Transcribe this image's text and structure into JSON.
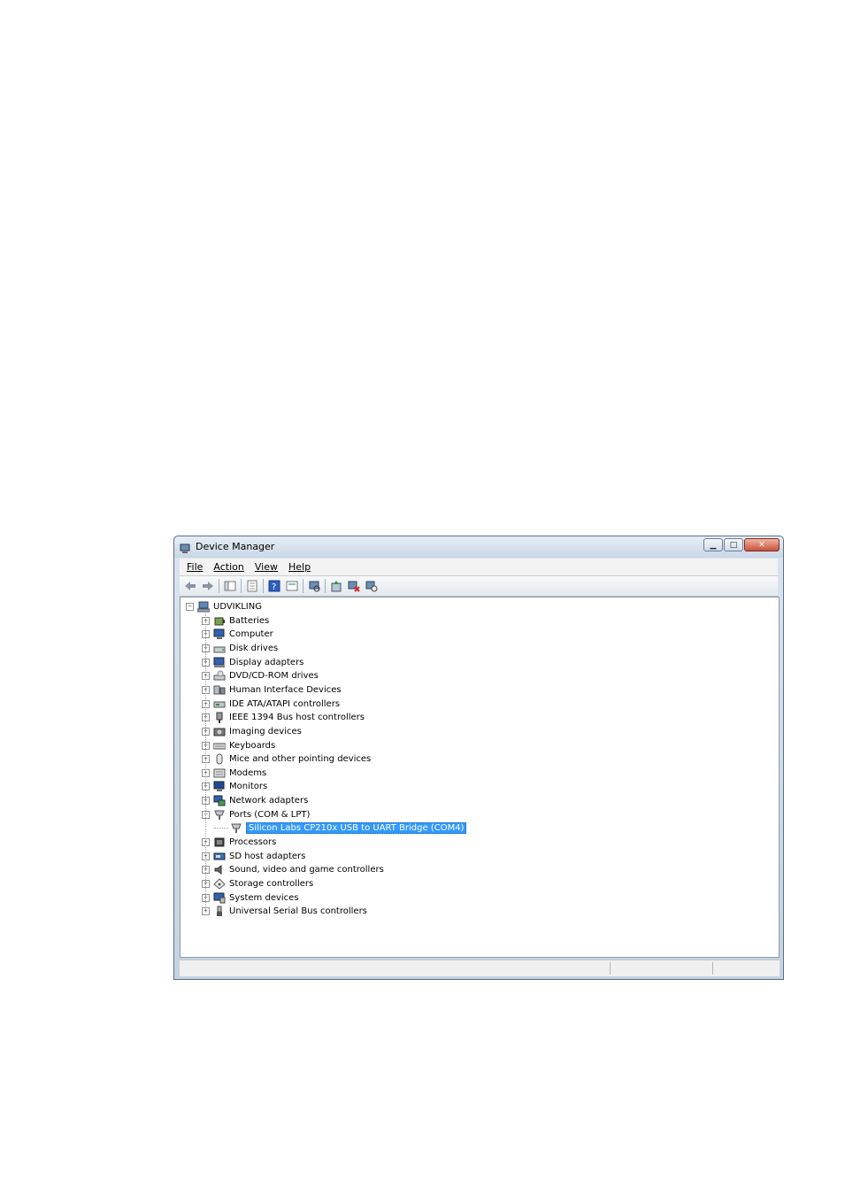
{
  "window": {
    "title": "Device Manager"
  },
  "window_buttons": [
    "minimize",
    "maximize",
    "close"
  ],
  "menu": [
    "File",
    "Action",
    "View",
    "Help"
  ],
  "toolbar_icons": [
    "back-icon",
    "forward-icon",
    "separator",
    "show-hide-tree-icon",
    "separator",
    "properties-icon",
    "separator",
    "help-icon",
    "action-view-icon",
    "separator",
    "scan-hardware-icon",
    "separator",
    "update-driver-icon",
    "uninstall-icon",
    "disable-icon"
  ],
  "tree": {
    "root": "UDVIKLING",
    "categories": [
      {
        "label": "Batteries",
        "icon": "battery-icon"
      },
      {
        "label": "Computer",
        "icon": "computer-icon"
      },
      {
        "label": "Disk drives",
        "icon": "disk-drive-icon"
      },
      {
        "label": "Display adapters",
        "icon": "display-adapter-icon"
      },
      {
        "label": "DVD/CD-ROM drives",
        "icon": "dvd-drive-icon"
      },
      {
        "label": "Human Interface Devices",
        "icon": "hid-icon"
      },
      {
        "label": "IDE ATA/ATAPI controllers",
        "icon": "ide-controller-icon"
      },
      {
        "label": "IEEE 1394 Bus host controllers",
        "icon": "ieee1394-icon"
      },
      {
        "label": "Imaging devices",
        "icon": "camera-icon"
      },
      {
        "label": "Keyboards",
        "icon": "keyboard-icon"
      },
      {
        "label": "Mice and other pointing devices",
        "icon": "mouse-icon"
      },
      {
        "label": "Modems",
        "icon": "modem-icon"
      },
      {
        "label": "Monitors",
        "icon": "monitor-icon"
      },
      {
        "label": "Network adapters",
        "icon": "network-adapter-icon"
      },
      {
        "label": "Ports (COM & LPT)",
        "icon": "port-icon",
        "expanded": true,
        "children": [
          {
            "label": "Silicon Labs CP210x USB to UART Bridge (COM4)",
            "icon": "port-icon",
            "selected": true
          }
        ]
      },
      {
        "label": "Processors",
        "icon": "processor-icon"
      },
      {
        "label": "SD host adapters",
        "icon": "sd-adapter-icon"
      },
      {
        "label": "Sound, video and game controllers",
        "icon": "speaker-icon"
      },
      {
        "label": "Storage controllers",
        "icon": "storage-controller-icon"
      },
      {
        "label": "System devices",
        "icon": "system-devices-icon"
      },
      {
        "label": "Universal Serial Bus controllers",
        "icon": "usb-icon"
      }
    ]
  },
  "colors": {
    "selection": "#3399ff",
    "title_bar": "#c9d7e5",
    "window_border": "#5a6f86"
  }
}
